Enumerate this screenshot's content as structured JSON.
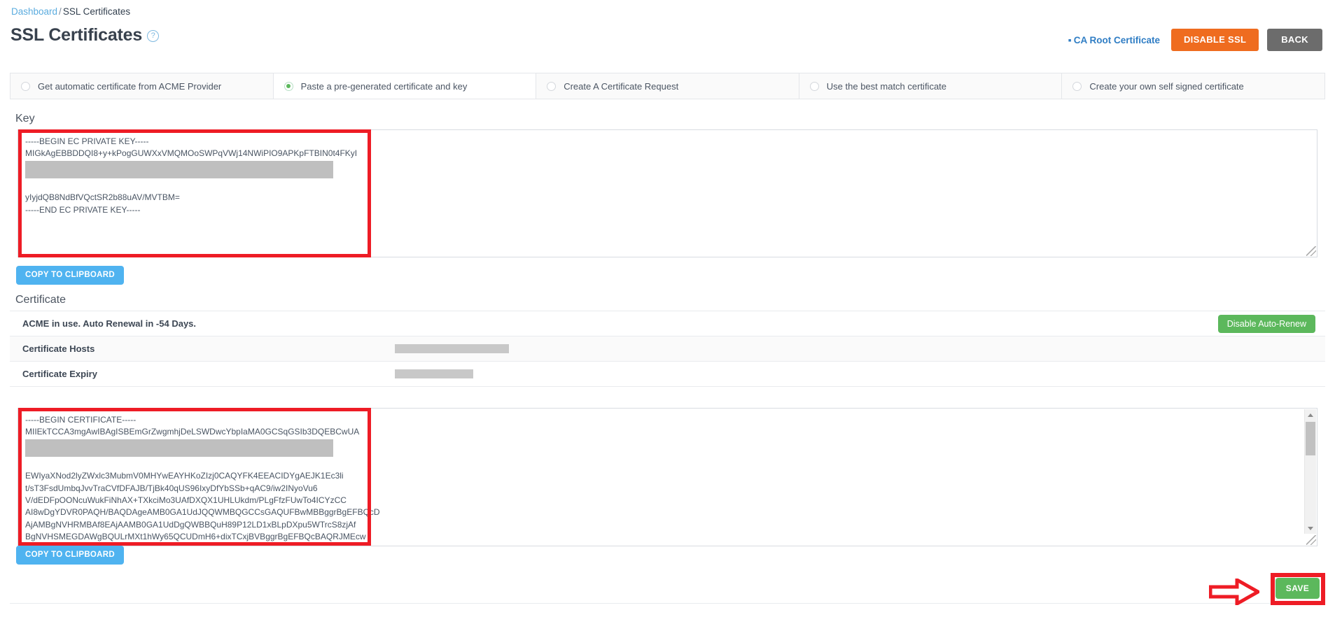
{
  "breadcrumb": {
    "root": "Dashboard",
    "separator": "/",
    "current": "SSL Certificates"
  },
  "header": {
    "title": "SSL Certificates",
    "help_icon": "question-circle-icon",
    "ca_root_link": "CA Root Certificate",
    "disable_ssl_label": "DISABLE SSL",
    "back_label": "BACK",
    "colors": {
      "disable_ssl": "#ef6c1f",
      "back": "#6c6c6c",
      "link": "#2f7dc4"
    }
  },
  "tabs": [
    {
      "label": "Get automatic certificate from ACME Provider",
      "selected": false
    },
    {
      "label": "Paste a pre-generated certificate and key",
      "selected": true
    },
    {
      "label": "Create A Certificate Request",
      "selected": false
    },
    {
      "label": "Use the best match certificate",
      "selected": false
    },
    {
      "label": "Create your own self signed certificate",
      "selected": false
    }
  ],
  "key_section": {
    "label": "Key",
    "lines": [
      "-----BEGIN EC PRIVATE KEY-----",
      "MIGkAgEBBDDQI8+y+kPogGUWXxVMQMOoSWPqVWj14NWiPIO9APKpFTBIN0t4FKyI",
      "[REDACTED]",
      "",
      "yIyjdQB8NdBfVQctSR2b88uAV/MVTBM=",
      "-----END EC PRIVATE KEY-----"
    ],
    "copy_label": "COPY TO CLIPBOARD"
  },
  "certificate_section": {
    "label": "Certificate",
    "status_text": "ACME in use. Auto Renewal in -54 Days.",
    "disable_auto_renew_label": "Disable Auto-Renew",
    "rows": [
      {
        "label": "Certificate Hosts",
        "value": "[REDACTED]",
        "redacted_width": 163
      },
      {
        "label": "Certificate Expiry",
        "value": "[REDACTED]",
        "redacted_width": 112
      }
    ],
    "lines": [
      "-----BEGIN CERTIFICATE-----",
      "MIIEkTCCA3mgAwIBAgISBEmGrZwgmhjDeLSWDwcYbpIaMA0GCSqGSIb3DQEBCwUA",
      "[REDACTED]",
      "",
      "EWIyaXNod2lyZWxlc3MubmV0MHYwEAYHKoZIzj0CAQYFK4EEACIDYgAEJK1Ec3li",
      "t/sT3FsdUmbqJvvTraCVfDFAJB/TjBk40qUS96IxyDfYbSSb+qAC9/iw2INyoVu6",
      "V/dEDFpOONcuWukFiNhAX+TXkciMo3UAfDXQX1UHLUkdm/PLgFfzFUwTo4ICYzCC",
      "AI8wDgYDVR0PAQH/BAQDAgeAMB0GA1UdJQQWMBQGCCsGAQUFBwMBBggrBgEFBQcD",
      "AjAMBgNVHRMBAf8EAjAAMB0GA1UdDgQWBBQuH89P12LD1xBLpDXpu5WTrcS8zjAf",
      "BgNVHSMEGDAWgBQULrMXt1hWy65QCUDmH6+dixTCxjBVBggrBgEFBQcBAQRJMEcw"
    ],
    "copy_label": "COPY TO CLIPBOARD"
  },
  "footer": {
    "save_label": "SAVE"
  },
  "annotations": {
    "arrow": "right-arrow-annotation",
    "boxes": [
      "key-textarea-highlight",
      "certificate-textarea-highlight",
      "save-button-highlight"
    ],
    "color": "#ee1c25"
  }
}
